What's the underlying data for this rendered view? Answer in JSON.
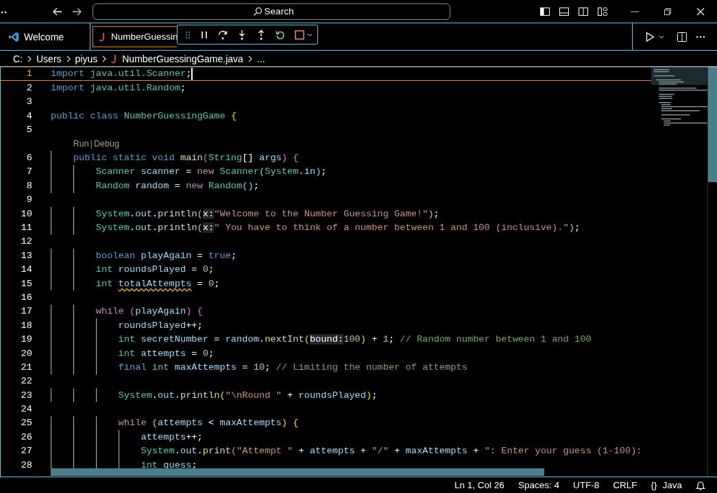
{
  "title_bar": {
    "search": {
      "placeholder": "Search"
    }
  },
  "tabs": [
    {
      "label": "Welcome",
      "kind": "start",
      "selected": false
    },
    {
      "label": "NumberGuessin",
      "kind": "file",
      "selected": true
    }
  ],
  "breadcrumbs": [
    {
      "label": "C:",
      "kind": "folder"
    },
    {
      "label": "Users",
      "kind": "folder"
    },
    {
      "label": "piyus",
      "kind": "folder"
    },
    {
      "label": "NumberGuessingGame.java",
      "kind": "file"
    },
    {
      "label": "...",
      "kind": "symbol"
    }
  ],
  "editor": {
    "lines": [
      {
        "number": "1",
        "current": true,
        "tokens": [
          {
            "kind": "kw",
            "text": "import"
          },
          {
            "kind": "type",
            "text": " java.util.Scanner"
          },
          {
            "kind": "plain",
            "text": ";"
          }
        ]
      },
      {
        "number": "2",
        "current": false,
        "tokens": [
          {
            "kind": "kw",
            "text": "import"
          },
          {
            "kind": "type",
            "text": " java.util.Random"
          },
          {
            "kind": "plain",
            "text": ";"
          }
        ]
      },
      {
        "number": "3",
        "current": false
      },
      {
        "number": "4",
        "current": false,
        "tokens": [
          {
            "kind": "kw",
            "text": "public"
          },
          {
            "kind": "kw",
            "text": " class"
          },
          {
            "kind": "type",
            "text": " NumberGuessingGame"
          },
          {
            "kind": "b1",
            "text": " {"
          }
        ]
      },
      {
        "number": "5",
        "current": false
      },
      {
        "number": "6",
        "current": false,
        "codelens": {
          "items": [
            "Run",
            "Debug"
          ],
          "separator": "|"
        },
        "tokens": [
          {
            "kind": "kw",
            "text": "    public"
          },
          {
            "kind": "kw",
            "text": " static"
          },
          {
            "kind": "kw",
            "text": " void"
          },
          {
            "kind": "fn",
            "text": " main"
          },
          {
            "kind": "b2",
            "text": "("
          },
          {
            "kind": "type",
            "text": "String"
          },
          {
            "kind": "plain",
            "text": "[]"
          },
          {
            "kind": "var",
            "text": " args"
          },
          {
            "kind": "b2",
            "text": ")"
          },
          {
            "kind": "b2",
            "text": " {"
          }
        ]
      },
      {
        "number": "7",
        "current": false,
        "tokens": [
          {
            "kind": "type",
            "text": "        Scanner"
          },
          {
            "kind": "var",
            "text": " scanner"
          },
          {
            "kind": "plain",
            "text": " ="
          },
          {
            "kind": "ctl",
            "text": " new"
          },
          {
            "kind": "type",
            "text": " Scanner"
          },
          {
            "kind": "b3",
            "text": "("
          },
          {
            "kind": "type",
            "text": "System"
          },
          {
            "kind": "plain",
            "text": "."
          },
          {
            "kind": "var",
            "text": "in"
          },
          {
            "kind": "b3",
            "text": ")"
          },
          {
            "kind": "plain",
            "text": ";"
          }
        ]
      },
      {
        "number": "8",
        "current": false,
        "tokens": [
          {
            "kind": "type",
            "text": "        Random"
          },
          {
            "kind": "var",
            "text": " random"
          },
          {
            "kind": "plain",
            "text": " ="
          },
          {
            "kind": "ctl",
            "text": " new"
          },
          {
            "kind": "type",
            "text": " Random"
          },
          {
            "kind": "b3",
            "text": "()"
          },
          {
            "kind": "plain",
            "text": ";"
          }
        ]
      },
      {
        "number": "9",
        "current": false
      },
      {
        "number": "10",
        "current": false,
        "tokens": [
          {
            "kind": "type",
            "text": "        System"
          },
          {
            "kind": "plain",
            "text": "."
          },
          {
            "kind": "var",
            "text": "out"
          },
          {
            "kind": "plain",
            "text": "."
          },
          {
            "kind": "fn",
            "text": "println"
          },
          {
            "kind": "b3",
            "text": "("
          },
          {
            "kind": "hint",
            "text": "x:"
          },
          {
            "kind": "str",
            "text": "\"Welcome to the Number Guessing Game!\""
          },
          {
            "kind": "b3",
            "text": ")"
          },
          {
            "kind": "plain",
            "text": ";"
          }
        ]
      },
      {
        "number": "11",
        "current": false,
        "tokens": [
          {
            "kind": "type",
            "text": "        System"
          },
          {
            "kind": "plain",
            "text": "."
          },
          {
            "kind": "var",
            "text": "out"
          },
          {
            "kind": "plain",
            "text": "."
          },
          {
            "kind": "fn",
            "text": "println"
          },
          {
            "kind": "b3",
            "text": "("
          },
          {
            "kind": "hint",
            "text": "x:"
          },
          {
            "kind": "str",
            "text": "\" You have to think of a number between 1 and 100 (inclusive).\""
          },
          {
            "kind": "b3",
            "text": ")"
          },
          {
            "kind": "plain",
            "text": ";"
          }
        ]
      },
      {
        "number": "12",
        "current": false
      },
      {
        "number": "13",
        "current": false,
        "tokens": [
          {
            "kind": "kw",
            "text": "        boolean"
          },
          {
            "kind": "var",
            "text": " playAgain"
          },
          {
            "kind": "plain",
            "text": " ="
          },
          {
            "kind": "kw",
            "text": " true"
          },
          {
            "kind": "plain",
            "text": ";"
          }
        ]
      },
      {
        "number": "14",
        "current": false,
        "tokens": [
          {
            "kind": "type",
            "text": "        int"
          },
          {
            "kind": "var",
            "text": " roundsPlayed"
          },
          {
            "kind": "plain",
            "text": " ="
          },
          {
            "kind": "num",
            "text": " 0"
          },
          {
            "kind": "plain",
            "text": ";"
          }
        ]
      },
      {
        "number": "15",
        "current": false,
        "tokens": [
          {
            "kind": "type",
            "text": "        int "
          },
          {
            "kind": "warn",
            "text": "totalAttempts"
          },
          {
            "kind": "plain",
            "text": " ="
          },
          {
            "kind": "num",
            "text": " 0"
          },
          {
            "kind": "plain",
            "text": ";"
          }
        ]
      },
      {
        "number": "16",
        "current": false
      },
      {
        "number": "17",
        "current": false,
        "tokens": [
          {
            "kind": "ctl",
            "text": "        while"
          },
          {
            "kind": "b2",
            "text": " ("
          },
          {
            "kind": "var",
            "text": "playAgain"
          },
          {
            "kind": "b2",
            "text": ")"
          },
          {
            "kind": "b2",
            "text": " {"
          }
        ]
      },
      {
        "number": "18",
        "current": false,
        "tokens": [
          {
            "kind": "var",
            "text": "            roundsPlayed"
          },
          {
            "kind": "plain",
            "text": "++;"
          }
        ]
      },
      {
        "number": "19",
        "current": false,
        "tokens": [
          {
            "kind": "type",
            "text": "            int"
          },
          {
            "kind": "var",
            "text": " secretNumber"
          },
          {
            "kind": "plain",
            "text": " ="
          },
          {
            "kind": "var",
            "text": " random"
          },
          {
            "kind": "plain",
            "text": "."
          },
          {
            "kind": "fn",
            "text": "nextInt"
          },
          {
            "kind": "b1",
            "text": "("
          },
          {
            "kind": "hint",
            "text": "bound:"
          },
          {
            "kind": "num",
            "text": "100"
          },
          {
            "kind": "b1",
            "text": ")"
          },
          {
            "kind": "plain",
            "text": " +"
          },
          {
            "kind": "num",
            "text": " 1"
          },
          {
            "kind": "plain",
            "text": ";"
          },
          {
            "kind": "com",
            "text": " // Random number between 1 and 100"
          }
        ]
      },
      {
        "number": "20",
        "current": false,
        "tokens": [
          {
            "kind": "type",
            "text": "            int"
          },
          {
            "kind": "var",
            "text": " attempts"
          },
          {
            "kind": "plain",
            "text": " ="
          },
          {
            "kind": "num",
            "text": " 0"
          },
          {
            "kind": "plain",
            "text": ";"
          }
        ]
      },
      {
        "number": "21",
        "current": false,
        "tokens": [
          {
            "kind": "kw",
            "text": "            final"
          },
          {
            "kind": "type",
            "text": " int"
          },
          {
            "kind": "var",
            "text": " maxAttempts"
          },
          {
            "kind": "plain",
            "text": " ="
          },
          {
            "kind": "num",
            "text": " 10"
          },
          {
            "kind": "plain",
            "text": ";"
          },
          {
            "kind": "com",
            "text": " // Limiting the number of attempts"
          }
        ]
      },
      {
        "number": "22",
        "current": false
      },
      {
        "number": "23",
        "current": false,
        "tokens": [
          {
            "kind": "type",
            "text": "            System"
          },
          {
            "kind": "plain",
            "text": "."
          },
          {
            "kind": "var",
            "text": "out"
          },
          {
            "kind": "plain",
            "text": "."
          },
          {
            "kind": "fn",
            "text": "println"
          },
          {
            "kind": "b1",
            "text": "("
          },
          {
            "kind": "str",
            "text": "\"\\nRound \""
          },
          {
            "kind": "plain",
            "text": " +"
          },
          {
            "kind": "var",
            "text": " roundsPlayed"
          },
          {
            "kind": "b1",
            "text": ")"
          },
          {
            "kind": "plain",
            "text": ";"
          }
        ]
      },
      {
        "number": "24",
        "current": false
      },
      {
        "number": "25",
        "current": false,
        "tokens": [
          {
            "kind": "ctl",
            "text": "            while"
          },
          {
            "kind": "b1",
            "text": " ("
          },
          {
            "kind": "var",
            "text": "attempts"
          },
          {
            "kind": "plain",
            "text": " <"
          },
          {
            "kind": "var",
            "text": " maxAttempts"
          },
          {
            "kind": "b1",
            "text": ")"
          },
          {
            "kind": "b1",
            "text": " {"
          }
        ]
      },
      {
        "number": "26",
        "current": false,
        "tokens": [
          {
            "kind": "var",
            "text": "                attempts"
          },
          {
            "kind": "plain",
            "text": "++;"
          }
        ]
      },
      {
        "number": "27",
        "current": false,
        "tokens": [
          {
            "kind": "type",
            "text": "                System"
          },
          {
            "kind": "plain",
            "text": "."
          },
          {
            "kind": "var",
            "text": "out"
          },
          {
            "kind": "plain",
            "text": "."
          },
          {
            "kind": "fn",
            "text": "print"
          },
          {
            "kind": "b2",
            "text": "("
          },
          {
            "kind": "str",
            "text": "\"Attempt \""
          },
          {
            "kind": "plain",
            "text": " +"
          },
          {
            "kind": "var",
            "text": " attempts"
          },
          {
            "kind": "plain",
            "text": " +"
          },
          {
            "kind": "str",
            "text": " \"/\""
          },
          {
            "kind": "plain",
            "text": " +"
          },
          {
            "kind": "var",
            "text": " maxAttempts"
          },
          {
            "kind": "plain",
            "text": " +"
          },
          {
            "kind": "str",
            "text": " \": Enter your guess (1-100):"
          }
        ]
      },
      {
        "number": "28",
        "current": false,
        "tokens": [
          {
            "kind": "type",
            "text": "                int"
          },
          {
            "kind": "var",
            "text": " guess"
          },
          {
            "kind": "plain",
            "text": ";"
          }
        ]
      }
    ]
  },
  "status_bar": {
    "position": "Ln 1, Col 26",
    "indentation": "Spaces: 4",
    "encoding": "UTF-8",
    "line_ending": "CRLF",
    "language_icon": "{}",
    "language": "Java"
  }
}
